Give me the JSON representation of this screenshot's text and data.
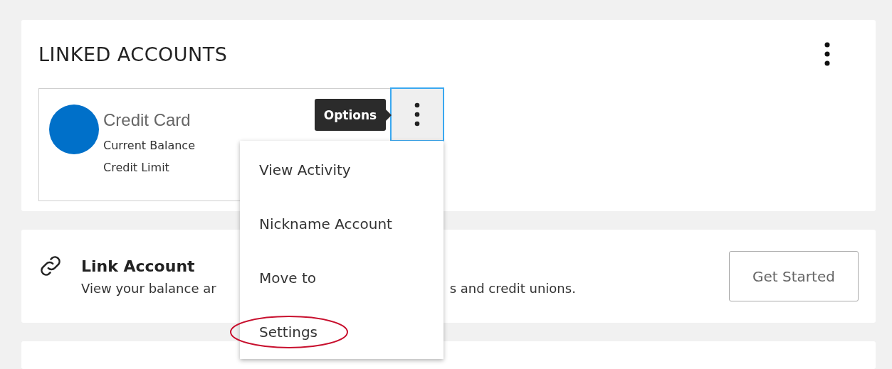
{
  "linked_accounts": {
    "title": "LINKED ACCOUNTS",
    "account": {
      "name": "Credit Card",
      "fields": [
        "Current Balance",
        "Credit Limit"
      ]
    }
  },
  "options_button": {
    "tooltip": "Options"
  },
  "menu": {
    "items": [
      {
        "label": "View Activity",
        "highlighted": false
      },
      {
        "label": "Nickname Account",
        "highlighted": false
      },
      {
        "label": "Move to",
        "highlighted": false
      },
      {
        "label": "Settings",
        "highlighted": true
      }
    ]
  },
  "link_account": {
    "title": "Link Account",
    "description_visible_parts": [
      "View your balance ar",
      "s and credit unions."
    ],
    "button": "Get Started"
  }
}
